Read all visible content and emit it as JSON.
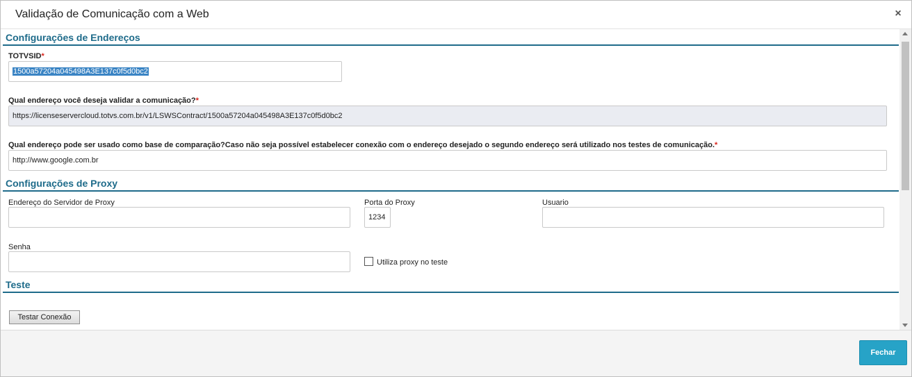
{
  "dialog": {
    "title": "Validação de Comunicação com a Web",
    "close_glyph": "×"
  },
  "sections": {
    "enderecos": "Configurações de Endereços",
    "proxy": "Configurações de Proxy",
    "teste": "Teste"
  },
  "fields": {
    "totvsid": {
      "label": "TOTVSID",
      "value": "1500a57204a045498A3E137c0f5d0bc2"
    },
    "endereco_validar": {
      "label": "Qual endereço você deseja validar a comunicação?",
      "value": "https://licenseservercloud.totvs.com.br/v1/LSWSContract/1500a57204a045498A3E137c0f5d0bc2"
    },
    "endereco_comparacao": {
      "label": "Qual endereço pode ser usado como base de comparação?Caso não seja possível estabelecer conexão com o endereço desejado o segundo endereço será utilizado nos testes de comunicação.",
      "value": "http://www.google.com.br"
    },
    "proxy_servidor": {
      "label": "Endereço do Servidor de Proxy",
      "value": ""
    },
    "proxy_porta": {
      "label": "Porta do Proxy",
      "value": "1234"
    },
    "proxy_usuario": {
      "label": "Usuario",
      "value": ""
    },
    "proxy_senha": {
      "label": "Senha",
      "value": ""
    },
    "utiliza_proxy": {
      "label": "Utiliza proxy no teste",
      "checked": false
    }
  },
  "required_mark": "*",
  "buttons": {
    "testar": "Testar Conexão",
    "fechar": "Fechar"
  },
  "colors": {
    "section_title": "#1e6b8a",
    "required": "#d9241c",
    "primary_button": "#27a3c7"
  }
}
